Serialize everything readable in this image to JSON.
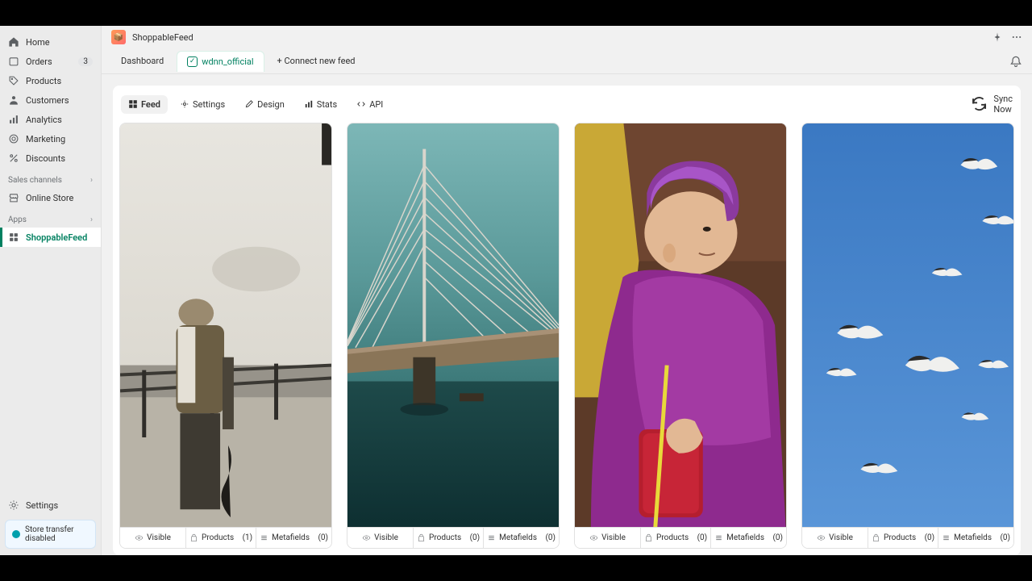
{
  "app_name": "ShoppableFeed",
  "sidebar": {
    "items": [
      {
        "icon": "home",
        "label": "Home"
      },
      {
        "icon": "orders",
        "label": "Orders",
        "badge": "3"
      },
      {
        "icon": "products",
        "label": "Products"
      },
      {
        "icon": "customers",
        "label": "Customers"
      },
      {
        "icon": "analytics",
        "label": "Analytics"
      },
      {
        "icon": "marketing",
        "label": "Marketing"
      },
      {
        "icon": "discounts",
        "label": "Discounts"
      }
    ],
    "sections": {
      "sales_channels": "Sales channels",
      "online_store": "Online Store",
      "apps": "Apps",
      "shoppablefeed": "ShoppableFeed"
    },
    "settings": "Settings",
    "store_banner": "Store transfer disabled"
  },
  "tabs": {
    "dashboard": "Dashboard",
    "feed_name": "wdnn_official",
    "connect": "+ Connect new feed"
  },
  "panel_tabs": {
    "feed": "Feed",
    "settings": "Settings",
    "design": "Design",
    "stats": "Stats",
    "api": "API"
  },
  "sync": "Sync Now",
  "card_labels": {
    "visible": "Visible",
    "products": "Products",
    "metafields": "Metafields"
  },
  "cards": [
    {
      "products": "(1)",
      "metafields": "(0)"
    },
    {
      "products": "(0)",
      "metafields": "(0)"
    },
    {
      "products": "(0)",
      "metafields": "(0)"
    },
    {
      "products": "(0)",
      "metafields": "(0)"
    }
  ]
}
